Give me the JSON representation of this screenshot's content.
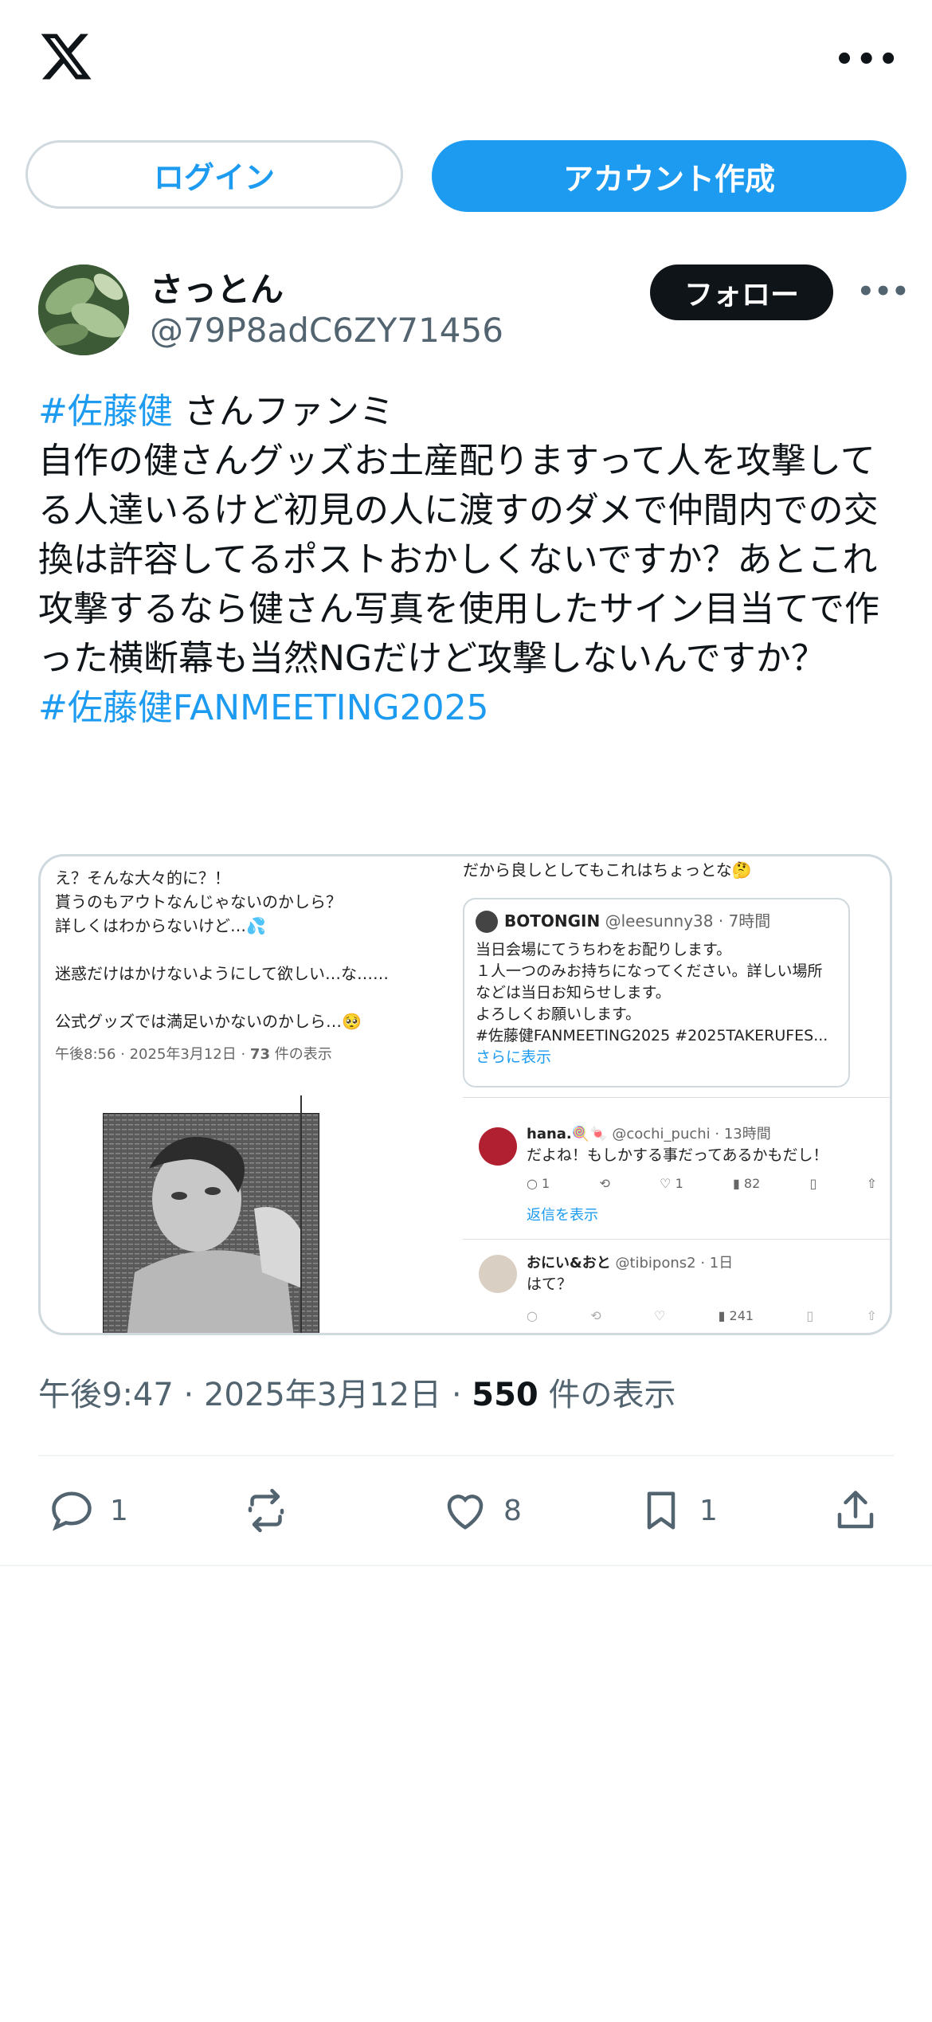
{
  "topbar": {
    "logo": "x-logo",
    "more": "•••"
  },
  "auth": {
    "login_label": "ログイン",
    "signup_label": "アカウント作成"
  },
  "post": {
    "author_name": "さっとん",
    "author_handle": "@79P8adC6ZY71456",
    "follow_label": "フォロー",
    "more": "•••",
    "hashtag1": "#佐藤健",
    "text_line1": " さんファンミ",
    "body": "自作の健さんグッズお土産配りますって人を攻撃してる人達いるけど初見の人に渡すのダメで仲間内での交換は許容してるポストおかしくないですか？あとこれ攻撃するなら健さん写真を使用したサイン目当てで作った横断幕も当然NGだけど攻撃しないんですか？",
    "hashtag2": "#佐藤健FANMEETING2025",
    "meta_time": "午後9:47 · 2025年3月12日 · ",
    "meta_views": "550",
    "meta_views_suffix": " 件の表示",
    "replies": "1",
    "reposts": "",
    "likes": "8",
    "bookmarks": "1"
  },
  "media": {
    "left_lines": [
      "え？そんな大々的に？！",
      "貰うのもアウトなんじゃないのかしら？",
      "詳しくはわからないけど…💦",
      "",
      "迷惑だけはかけないようにして欲しい…な……",
      "",
      "公式グッズでは満足いかないのかしら…🥺"
    ],
    "left_meta_time": "午後8:56 · 2025年3月12日 · ",
    "left_meta_views": "73",
    "left_meta_suffix": " 件の表示",
    "right_top": "だから良しとしてもこれはちょっとな🤔",
    "quote_name": "BOTONGIN",
    "quote_handle": "@leesunny38 · 7時間",
    "quote_lines": [
      "当日会場にてうちわをお配りします。",
      "１人一つのみお持ちになってください。詳しい場所",
      "などは当日お知らせします。",
      "よろしくお願いします。",
      "#佐藤健FANMEETING2025 #2025TAKERUFES..."
    ],
    "quote_more": "さらに表示",
    "reply1_name": "hana.🍭🍬",
    "reply1_handle": "@cochi_puchi · 13時間",
    "reply1_text": "だよね！もしかする事だってあるかもだし！",
    "reply1_replies": "1",
    "reply1_likes": "1",
    "reply1_views": "82",
    "show_replies": "返信を表示",
    "reply2_name": "おにい&おと",
    "reply2_handle": "@tibipons2 · 1日",
    "reply2_text": "はて？",
    "reply2_views": "241"
  }
}
